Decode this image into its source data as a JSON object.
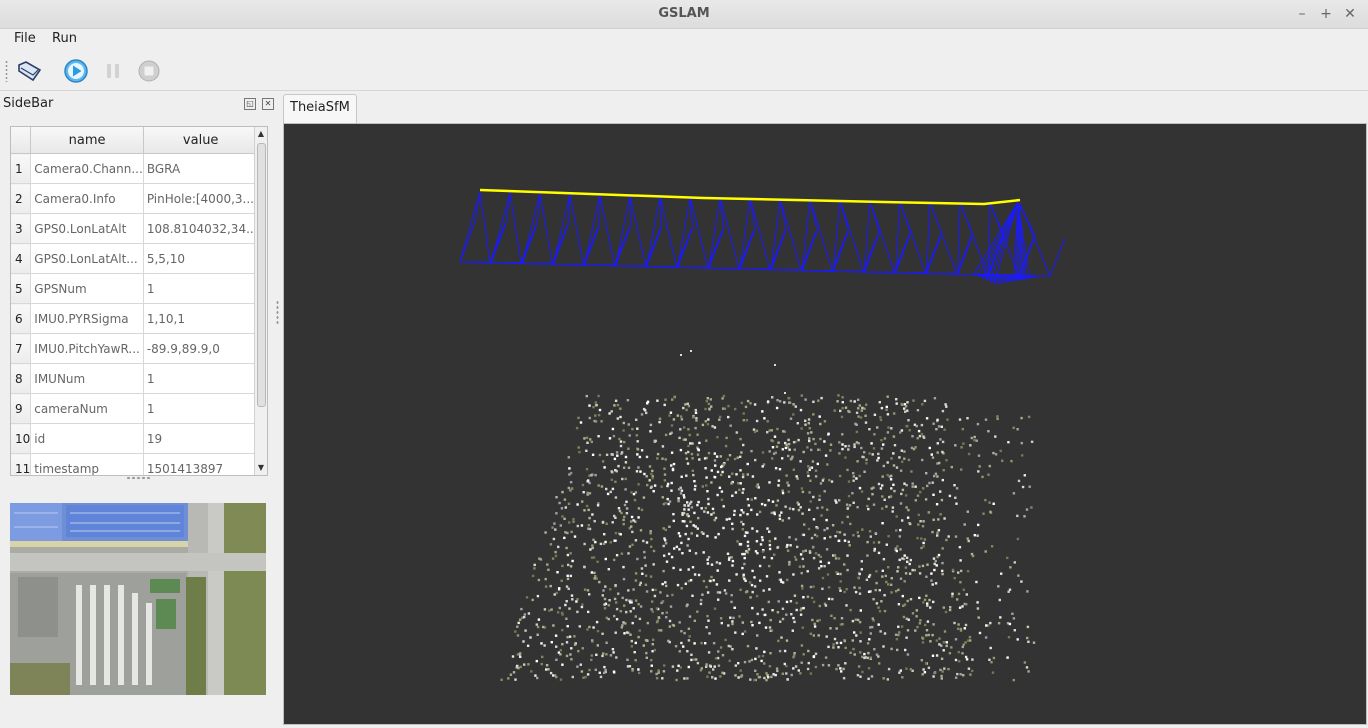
{
  "window": {
    "title": "GSLAM"
  },
  "menu": {
    "file": "File",
    "run": "Run"
  },
  "toolbar": {
    "open_icon": "folder-open-icon",
    "play_icon": "play-icon",
    "pause_icon": "pause-icon",
    "stop_icon": "stop-icon"
  },
  "sidebar": {
    "title": "SideBar",
    "table": {
      "headers": [
        "name",
        "value"
      ],
      "rows": [
        {
          "num": "1",
          "name": "Camera0.Chann...",
          "value": "BGRA"
        },
        {
          "num": "2",
          "name": "Camera0.Info",
          "value": "PinHole:[4000,3..."
        },
        {
          "num": "3",
          "name": "GPS0.LonLatAlt",
          "value": "108.8104032,34..."
        },
        {
          "num": "4",
          "name": "GPS0.LonLatAlt...",
          "value": "5,5,10"
        },
        {
          "num": "5",
          "name": "GPSNum",
          "value": "1"
        },
        {
          "num": "6",
          "name": "IMU0.PYRSigma",
          "value": "1,10,1"
        },
        {
          "num": "7",
          "name": "IMU0.PitchYawR...",
          "value": "-89.9,89.9,0"
        },
        {
          "num": "8",
          "name": "IMUNum",
          "value": "1"
        },
        {
          "num": "9",
          "name": "cameraNum",
          "value": "1"
        },
        {
          "num": "10",
          "name": "id",
          "value": "19"
        },
        {
          "num": "11",
          "name": "timestamp",
          "value": "1501413897"
        }
      ]
    }
  },
  "tabs": [
    {
      "label": "TheiaSfM"
    }
  ],
  "colors": {
    "viewport_bg": "#333333",
    "camera_frustum": "#1a1aff",
    "trajectory": "#ffff00"
  }
}
